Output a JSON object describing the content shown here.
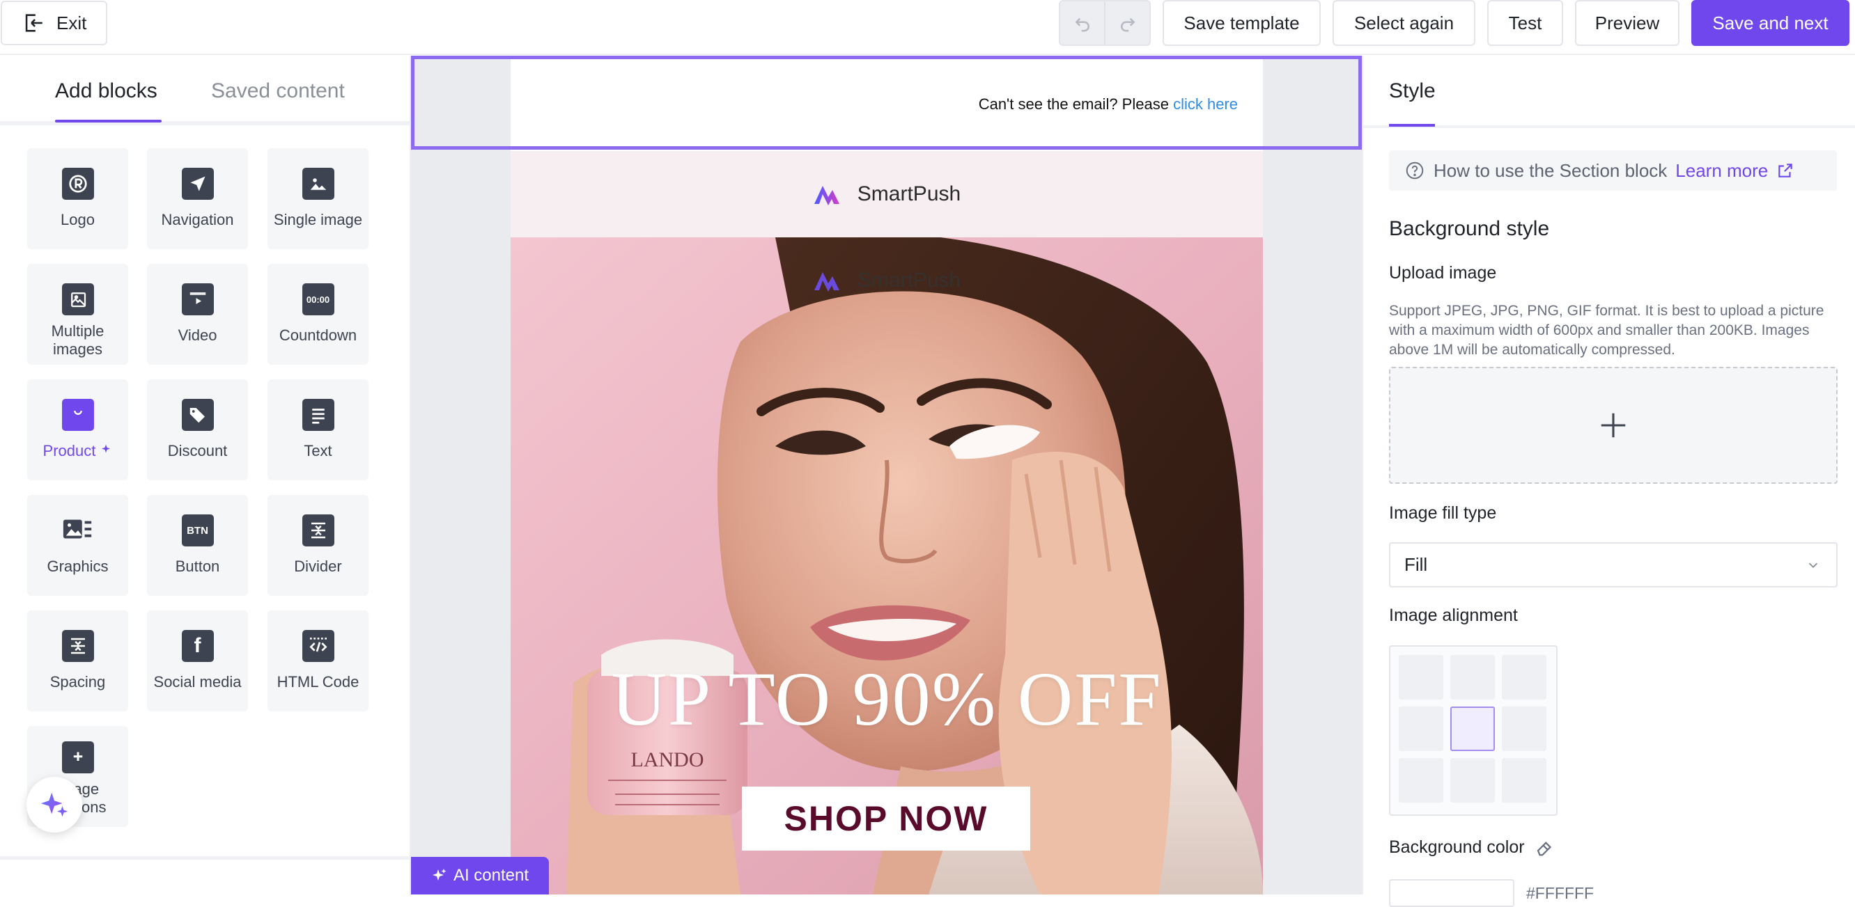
{
  "toolbar": {
    "exit_label": "Exit",
    "save_template_label": "Save template",
    "select_again_label": "Select again",
    "test_label": "Test",
    "preview_label": "Preview",
    "save_next_label": "Save and next",
    "accent_color": "#7047ec"
  },
  "left_panel": {
    "tabs": [
      {
        "label": "Add blocks"
      },
      {
        "label": "Saved content"
      }
    ],
    "blocks": [
      {
        "label": "Logo",
        "icon": "logo-icon"
      },
      {
        "label": "Navigation",
        "icon": "navigation-icon"
      },
      {
        "label": "Single image",
        "icon": "image-icon"
      },
      {
        "label": "Multiple images",
        "icon": "multiple-images-icon"
      },
      {
        "label": "Video",
        "icon": "video-icon"
      },
      {
        "label": "Countdown",
        "icon": "countdown-icon"
      },
      {
        "label": "Product",
        "icon": "product-bag-icon"
      },
      {
        "label": "Discount",
        "icon": "discount-tag-icon"
      },
      {
        "label": "Text",
        "icon": "text-icon"
      },
      {
        "label": "Graphics",
        "icon": "graphics-icon"
      },
      {
        "label": "Button",
        "icon": "button-icon"
      },
      {
        "label": "Divider",
        "icon": "divider-icon"
      },
      {
        "label": "Spacing",
        "icon": "spacing-icon"
      },
      {
        "label": "Social media",
        "icon": "facebook-icon"
      },
      {
        "label": "HTML Code",
        "icon": "html-code-icon"
      },
      {
        "label": "Image captions",
        "icon": "image-captions-icon"
      }
    ],
    "countdown_glyph": "00:00",
    "button_glyph": "BTN"
  },
  "canvas": {
    "preheader_text": "Can't see the email? Please",
    "preheader_link": "click here",
    "brand_name": "SmartPush",
    "hero_headline": "UP TO 90% OFF",
    "cta_label": "SHOP NOW",
    "ai_content_label": "AI content"
  },
  "right_panel": {
    "tab_label": "Style",
    "help_text": "How to use the Section block",
    "learn_more": "Learn more",
    "background_style_heading": "Background style",
    "upload_image_label": "Upload image",
    "upload_description": "Support JPEG, JPG, PNG, GIF format. It is best to upload a picture with a maximum width of 600px and smaller than 200KB. Images above 1M will be automatically compressed.",
    "image_fill_type_label": "Image fill type",
    "fill_value": "Fill",
    "image_alignment_label": "Image alignment",
    "alignment_selected": "middle-center",
    "background_color_label": "Background color",
    "background_color_value": "#FFFFFF"
  }
}
